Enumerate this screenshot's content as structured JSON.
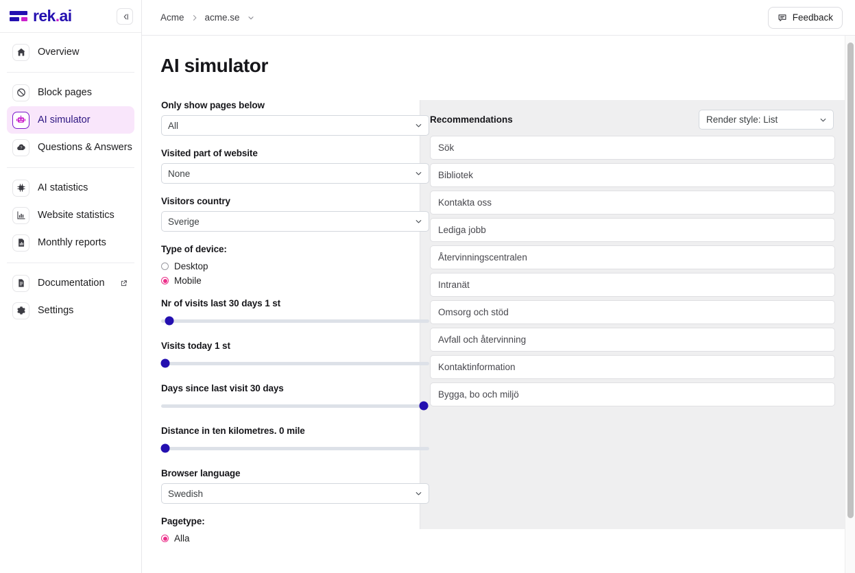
{
  "brand": {
    "name": "rek.ai",
    "mark": "logo-mark",
    "collapse_icon": "collapse-sidebar-icon"
  },
  "sidebar": {
    "groups": [
      {
        "items": [
          {
            "label": "Overview",
            "icon": "home-icon",
            "active": false
          }
        ]
      },
      {
        "items": [
          {
            "label": "Block pages",
            "icon": "block-icon",
            "active": false
          },
          {
            "label": "AI simulator",
            "icon": "robot-icon",
            "active": true
          },
          {
            "label": "Questions & Answers",
            "icon": "question-cloud-icon",
            "active": false
          }
        ]
      },
      {
        "items": [
          {
            "label": "AI statistics",
            "icon": "chip-icon",
            "active": false
          },
          {
            "label": "Website statistics",
            "icon": "bar-chart-icon",
            "active": false
          },
          {
            "label": "Monthly reports",
            "icon": "report-document-icon",
            "active": false
          }
        ]
      },
      {
        "items": [
          {
            "label": "Documentation",
            "icon": "document-icon",
            "active": false,
            "external": true
          },
          {
            "label": "Settings",
            "icon": "gear-icon",
            "active": false
          }
        ]
      }
    ]
  },
  "topbar": {
    "breadcrumb": [
      "Acme",
      "acme.se"
    ],
    "separator_icon": "chevron-right-icon",
    "dropdown_icon": "chevron-down-icon",
    "feedback_label": "Feedback",
    "feedback_icon": "comment-icon"
  },
  "page": {
    "title": "AI simulator"
  },
  "filters": {
    "pages_below": {
      "label": "Only show pages below",
      "value": "All"
    },
    "visited_part": {
      "label": "Visited part of website",
      "value": "None"
    },
    "visitors_country": {
      "label": "Visitors country",
      "value": "Sverige"
    },
    "device": {
      "label": "Type of device:",
      "options": [
        {
          "label": "Desktop",
          "selected": false
        },
        {
          "label": "Mobile",
          "selected": true
        }
      ]
    },
    "sliders": [
      {
        "label": "Nr of visits last 30 days 1 st",
        "percent": 3
      },
      {
        "label": "Visits today 1 st",
        "percent": 1
      },
      {
        "label": "Days since last visit 30 days",
        "percent": 98
      },
      {
        "label": "Distance in ten kilometres. 0 mile",
        "percent": 1
      }
    ],
    "browser_language": {
      "label": "Browser language",
      "value": "Swedish"
    },
    "pagetype": {
      "label": "Pagetype:",
      "options": [
        {
          "label": "Alla",
          "selected": true
        }
      ]
    }
  },
  "recommendations": {
    "title": "Recommendations",
    "render_style": {
      "value": "Render style: List"
    },
    "items": [
      "Sök",
      "Bibliotek",
      "Kontakta oss",
      "Lediga jobb",
      "Återvinningscentralen",
      "Intranät",
      "Omsorg och stöd",
      "Avfall och återvinning",
      "Kontaktinformation",
      "Bygga, bo och miljö"
    ]
  },
  "colors": {
    "brand_blue": "#2410b0",
    "brand_magenta": "#cc22cc",
    "accent_pink": "#ec2f8a",
    "active_bg": "#f9e6fb",
    "panel_bg": "#efeff0"
  }
}
